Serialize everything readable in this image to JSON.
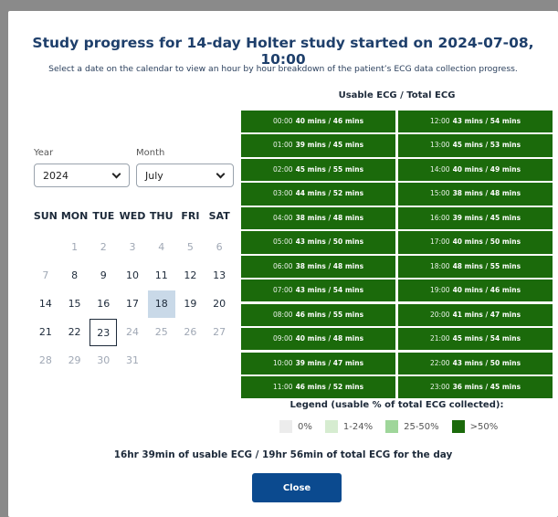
{
  "modal": {
    "title": "Study progress for 14-day Holter study started on 2024-07-08, 10:00",
    "subtitle": "Select a date on the calendar to view an hour by hour breakdown of the patient’s ECG data collection progress."
  },
  "calendar": {
    "year_label": "Year",
    "year_value": "2024",
    "month_label": "Month",
    "month_value": "July",
    "weekdays": [
      "SUN",
      "MON",
      "TUE",
      "WED",
      "THU",
      "FRI",
      "SAT"
    ],
    "weeks": [
      [
        null,
        {
          "d": "1",
          "s": "dim"
        },
        {
          "d": "2",
          "s": "dim"
        },
        {
          "d": "3",
          "s": "dim"
        },
        {
          "d": "4",
          "s": "dim"
        },
        {
          "d": "5",
          "s": "dim"
        },
        {
          "d": "6",
          "s": "dim"
        }
      ],
      [
        {
          "d": "7",
          "s": "dim"
        },
        {
          "d": "8",
          "s": "active"
        },
        {
          "d": "9",
          "s": "active"
        },
        {
          "d": "10",
          "s": "active"
        },
        {
          "d": "11",
          "s": "active"
        },
        {
          "d": "12",
          "s": "active"
        },
        {
          "d": "13",
          "s": "active"
        }
      ],
      [
        {
          "d": "14",
          "s": "active"
        },
        {
          "d": "15",
          "s": "active"
        },
        {
          "d": "16",
          "s": "active"
        },
        {
          "d": "17",
          "s": "active"
        },
        {
          "d": "18",
          "s": "highlight"
        },
        {
          "d": "19",
          "s": "active"
        },
        {
          "d": "20",
          "s": "active"
        }
      ],
      [
        {
          "d": "21",
          "s": "active"
        },
        {
          "d": "22",
          "s": "active"
        },
        {
          "d": "23",
          "s": "selected"
        },
        {
          "d": "24",
          "s": "dim"
        },
        {
          "d": "25",
          "s": "dim"
        },
        {
          "d": "26",
          "s": "dim"
        },
        {
          "d": "27",
          "s": "dim"
        }
      ],
      [
        {
          "d": "28",
          "s": "dim"
        },
        {
          "d": "29",
          "s": "dim"
        },
        {
          "d": "30",
          "s": "dim"
        },
        {
          "d": "31",
          "s": "dim"
        },
        null,
        null,
        null
      ]
    ]
  },
  "hourly": {
    "title": "Usable ECG / Total ECG",
    "cells": [
      {
        "time": "00:00",
        "value": "40 mins / 46 mins"
      },
      {
        "time": "01:00",
        "value": "39 mins / 45 mins"
      },
      {
        "time": "02:00",
        "value": "45 mins / 55 mins"
      },
      {
        "time": "03:00",
        "value": "44 mins / 52 mins"
      },
      {
        "time": "04:00",
        "value": "38 mins / 48 mins"
      },
      {
        "time": "05:00",
        "value": "43 mins / 50 mins"
      },
      {
        "time": "06:00",
        "value": "38 mins / 48 mins"
      },
      {
        "time": "07:00",
        "value": "43 mins / 54 mins"
      },
      {
        "time": "08:00",
        "value": "46 mins / 55 mins"
      },
      {
        "time": "09:00",
        "value": "40 mins / 48 mins"
      },
      {
        "time": "10:00",
        "value": "39 mins / 47 mins"
      },
      {
        "time": "11:00",
        "value": "46 mins / 52 mins"
      },
      {
        "time": "12:00",
        "value": "43 mins / 54 mins"
      },
      {
        "time": "13:00",
        "value": "45 mins / 53 mins"
      },
      {
        "time": "14:00",
        "value": "40 mins / 49 mins"
      },
      {
        "time": "15:00",
        "value": "38 mins / 48 mins"
      },
      {
        "time": "16:00",
        "value": "39 mins / 45 mins"
      },
      {
        "time": "17:00",
        "value": "40 mins / 50 mins"
      },
      {
        "time": "18:00",
        "value": "48 mins / 55 mins"
      },
      {
        "time": "19:00",
        "value": "40 mins / 46 mins"
      },
      {
        "time": "20:00",
        "value": "41 mins / 47 mins"
      },
      {
        "time": "21:00",
        "value": "45 mins / 54 mins"
      },
      {
        "time": "22:00",
        "value": "43 mins / 50 mins"
      },
      {
        "time": "23:00",
        "value": "36 mins / 45 mins"
      }
    ]
  },
  "legend": {
    "title": "Legend (usable % of total ECG collected):",
    "items": [
      {
        "label": "0%",
        "color": "#ececec"
      },
      {
        "label": "1-24%",
        "color": "#d6ecd0"
      },
      {
        "label": "25-50%",
        "color": "#9fd69a"
      },
      {
        "label": ">50%",
        "color": "#1b6a0b"
      }
    ]
  },
  "summary": "16hr 39min of usable ECG / 19hr 56min of total ECG for the day",
  "close_label": "Close"
}
